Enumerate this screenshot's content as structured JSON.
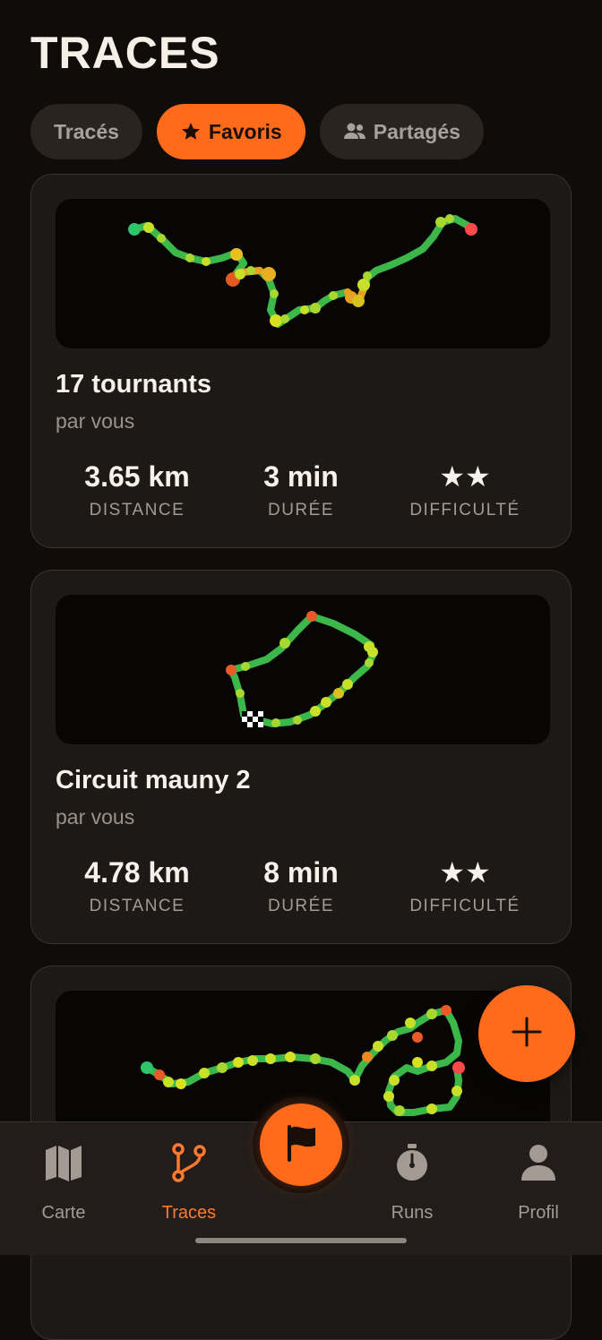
{
  "header": {
    "title": "TRACES"
  },
  "tabs": [
    {
      "label": "Tracés",
      "icon": "",
      "active": false
    },
    {
      "label": "Favoris",
      "icon": "star-icon",
      "active": true
    },
    {
      "label": "Partagés",
      "icon": "people-icon",
      "active": false
    }
  ],
  "colors": {
    "accent": "#ff6b1a",
    "route_green": "#3cb84a",
    "route_yellow": "#c8e028",
    "route_orange": "#f08a1c",
    "route_red": "#e63c2e",
    "start_dot": "#2ec46a",
    "end_dot": "#ff4a4a"
  },
  "cards": [
    {
      "name": "17 tournants",
      "author": "par vous",
      "stats": {
        "distance": {
          "value": "3.65 km",
          "label": "DISTANCE"
        },
        "duration": {
          "value": "3 min",
          "label": "DURÉE"
        },
        "difficulty": {
          "value": "★★",
          "label": "DIFFICULTÉ"
        }
      }
    },
    {
      "name": "Circuit mauny 2",
      "author": "par vous",
      "stats": {
        "distance": {
          "value": "4.78 km",
          "label": "DISTANCE"
        },
        "duration": {
          "value": "8 min",
          "label": "DURÉE"
        },
        "difficulty": {
          "value": "★★",
          "label": "DIFFICULTÉ"
        }
      }
    },
    {
      "name": "",
      "author": ""
    }
  ],
  "fab": {
    "icon": "plus-icon"
  },
  "nav": {
    "items": [
      {
        "label": "Carte",
        "icon": "map-icon",
        "active": false
      },
      {
        "label": "Traces",
        "icon": "route-icon",
        "active": true
      },
      {
        "label": "Runs",
        "icon": "stopwatch-icon",
        "active": false
      },
      {
        "label": "Profil",
        "icon": "user-icon",
        "active": false
      }
    ],
    "center": {
      "icon": "flag-icon"
    }
  }
}
